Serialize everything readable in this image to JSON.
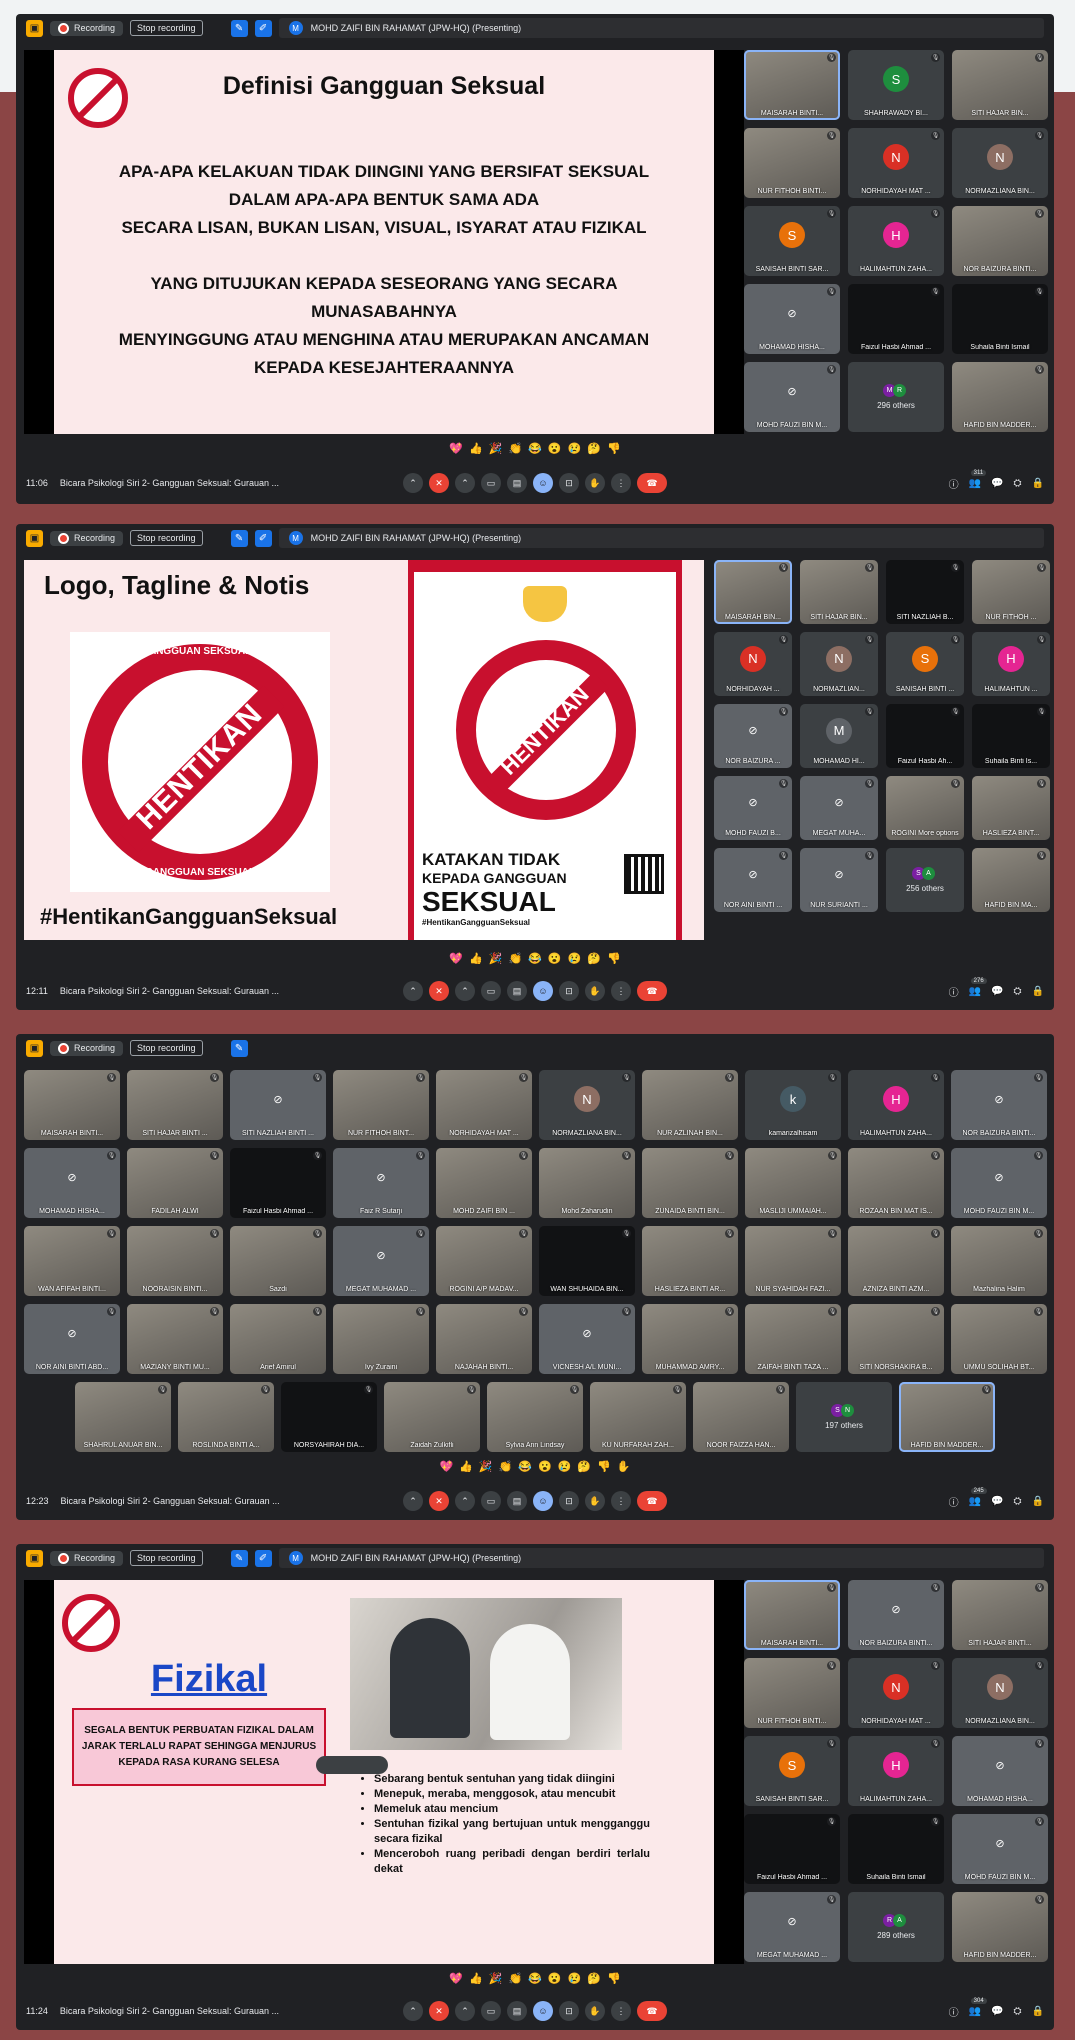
{
  "panels": [
    {
      "recording_label": "Recording",
      "stop_label": "Stop recording",
      "presenter_initial": "M",
      "presenter": "MOHD ZAIFI BIN RAHAMAT (JPW-HQ) (Presenting)",
      "slide": {
        "title": "Definisi Gangguan Seksual",
        "p1": [
          "APA-APA KELAKUAN TIDAK DIINGINI YANG BERSIFAT SEKSUAL",
          "DALAM APA-APA BENTUK SAMA ADA",
          "SECARA LISAN, BUKAN LISAN, VISUAL, ISYARAT ATAU FIZIKAL"
        ],
        "p2": [
          "YANG DITUJUKAN KEPADA SESEORANG YANG SECARA",
          "MUNASABAHNYA",
          "MENYINGGUNG ATAU MENGHINA ATAU MERUPAKAN ANCAMAN",
          "KEPADA KESEJAHTERAANNYA"
        ]
      },
      "tiles": [
        {
          "name": "MAISARAH BINTI...",
          "kind": "photo",
          "active": true
        },
        {
          "name": "SHAHRAWADY BI...",
          "initial": "S",
          "color": "#1e8e3e"
        },
        {
          "name": "SITI HAJAR BIN...",
          "kind": "photo"
        },
        {
          "name": "NUR FITHOH BINTI...",
          "kind": "photo"
        },
        {
          "name": "NORHIDAYAH MAT ...",
          "initial": "N",
          "color": "#d93025"
        },
        {
          "name": "NORMAZLIANA BIN...",
          "initial": "N",
          "color": "#8d6e63"
        },
        {
          "name": "SANISAH BINTI SAR...",
          "initial": "S",
          "color": "#e8710a"
        },
        {
          "name": "HALIMAHTUN ZAHA...",
          "initial": "H",
          "color": "#e52592"
        },
        {
          "name": "NOR BAIZURA BINTI...",
          "kind": "photo"
        },
        {
          "name": "MOHAMAD HISHA...",
          "kind": "grey"
        },
        {
          "name": "Faizul Hasbi Ahmad ...",
          "kind": "dark"
        },
        {
          "name": "Suhaila Binti Ismail",
          "kind": "dark"
        },
        {
          "name": "MOHD FAUZI BIN M...",
          "kind": "grey"
        },
        {
          "name": "296 others",
          "kind": "others",
          "a": "M",
          "b": "R"
        },
        {
          "name": "HAFID BIN MADDER...",
          "kind": "photo"
        }
      ],
      "reactions": [
        "💖",
        "👍",
        "🎉",
        "👏",
        "😂",
        "😮",
        "😢",
        "🤔",
        "👎"
      ],
      "time": "11:06",
      "meeting_title": "Bicara Psikologi Siri 2- Gangguan Seksual: Gurauan ...",
      "participants_count": "311"
    },
    {
      "recording_label": "Recording",
      "stop_label": "Stop recording",
      "presenter_initial": "M",
      "presenter": "MOHD ZAIFI BIN RAHAMAT (JPW-HQ) (Presenting)",
      "slide": {
        "title": "Logo, Tagline & Notis",
        "ring_top": "ANTIGANGGUAN SEKSUAL (AGS)",
        "ring_mid": "HENTIKAN",
        "ring_bottom": "GANGGUAN SEKSUAL",
        "hashtag": "#HentikanGangguanSeksual",
        "poster_line1": "KATAKAN TIDAK",
        "poster_line2": "KEPADA GANGGUAN",
        "poster_line3": "SEKSUAL",
        "poster_hashtag": "#HentikanGangguanSeksual"
      },
      "tiles": [
        {
          "name": "MAISARAH BIN...",
          "kind": "photo",
          "active": true
        },
        {
          "name": "SITI HAJAR BIN...",
          "kind": "photo"
        },
        {
          "name": "SITI NAZLIAH B...",
          "kind": "dark"
        },
        {
          "name": "NUR FITHOH ...",
          "kind": "photo"
        },
        {
          "name": "NORHIDAYAH ...",
          "initial": "N",
          "color": "#d93025"
        },
        {
          "name": "NORMAZLIAN...",
          "initial": "N",
          "color": "#8d6e63"
        },
        {
          "name": "SANISAH BINTI ...",
          "initial": "S",
          "color": "#e8710a"
        },
        {
          "name": "HALIMAHTUN ...",
          "initial": "H",
          "color": "#e52592"
        },
        {
          "name": "NOR BAIZURA ...",
          "kind": "grey"
        },
        {
          "name": "MOHAMAD HI...",
          "initial": "M",
          "color": "#5f6368"
        },
        {
          "name": "Faizul Hasbi Ah...",
          "kind": "dark"
        },
        {
          "name": "Suhaila Binti Is...",
          "kind": "dark"
        },
        {
          "name": "MOHD FAUZI B...",
          "kind": "grey"
        },
        {
          "name": "MEGAT MUHA...",
          "kind": "grey"
        },
        {
          "name": "ROGINI  More options",
          "kind": "photo"
        },
        {
          "name": "HASLIEZA BINT...",
          "kind": "photo"
        },
        {
          "name": "NOR AINI BINTI ...",
          "kind": "grey"
        },
        {
          "name": "NUR SURIANTI ...",
          "kind": "grey"
        },
        {
          "name": "256 others",
          "kind": "others",
          "a": "S",
          "b": "A"
        },
        {
          "name": "HAFID BIN MA...",
          "kind": "photo"
        }
      ],
      "reactions": [
        "💖",
        "👍",
        "🎉",
        "👏",
        "😂",
        "😮",
        "😢",
        "🤔",
        "👎"
      ],
      "time": "12:11",
      "meeting_title": "Bicara Psikologi Siri 2- Gangguan Seksual: Gurauan ...",
      "participants_count": "276"
    },
    {
      "recording_label": "Recording",
      "stop_label": "Stop recording",
      "tiles": [
        {
          "name": "MAISARAH BINTI...",
          "kind": "photo"
        },
        {
          "name": "SITI HAJAR BINTI ...",
          "kind": "photo"
        },
        {
          "name": "SITI NAZLIAH BINTI ...",
          "kind": "grey"
        },
        {
          "name": "NUR FITHOH BINT...",
          "kind": "photo"
        },
        {
          "name": "NORHIDAYAH MAT ...",
          "kind": "photo"
        },
        {
          "name": "NORMAZLIANA BIN...",
          "initial": "N",
          "color": "#8d6e63"
        },
        {
          "name": "NUR AZLINAH BIN...",
          "kind": "photo"
        },
        {
          "name": "kamarizalhisam",
          "initial": "k",
          "color": "#455a64"
        },
        {
          "name": "HALIMAHTUN ZAHA...",
          "initial": "H",
          "color": "#e52592"
        },
        {
          "name": "NOR BAIZURA BINTI...",
          "kind": "grey"
        },
        {
          "name": "MOHAMAD HISHA...",
          "kind": "grey"
        },
        {
          "name": "FADILAH ALWI",
          "kind": "photo"
        },
        {
          "name": "Faizul Hasbi Ahmad ...",
          "kind": "dark"
        },
        {
          "name": "Faiz R Sutarji",
          "kind": "grey"
        },
        {
          "name": "MOHD ZAIFI BIN ...",
          "kind": "photo"
        },
        {
          "name": "Mohd Zaharudin",
          "kind": "photo"
        },
        {
          "name": "ZUNAIDA BINTI BIN...",
          "kind": "photo"
        },
        {
          "name": "MASLIJI UMMAIAH...",
          "kind": "photo"
        },
        {
          "name": "ROZAAN BIN MAT IS...",
          "kind": "photo"
        },
        {
          "name": "MOHD FAUZI BIN M...",
          "kind": "grey"
        },
        {
          "name": "WAN AFIFAH BINTI...",
          "kind": "photo"
        },
        {
          "name": "NOORAISIN BINTI...",
          "kind": "photo"
        },
        {
          "name": "Sazdi",
          "kind": "photo"
        },
        {
          "name": "MEGAT MUHAMAD ...",
          "kind": "grey"
        },
        {
          "name": "ROGINI A/P MADAV...",
          "kind": "photo"
        },
        {
          "name": "WAN SHUHAIDA BIN...",
          "kind": "dark"
        },
        {
          "name": "HASLIEZA BINTI AR...",
          "kind": "photo"
        },
        {
          "name": "NUR SYAHIDAH FAZI...",
          "kind": "photo"
        },
        {
          "name": "AZNIZA BINTI AZM...",
          "kind": "photo"
        },
        {
          "name": "Mazhalina Halim",
          "kind": "photo"
        },
        {
          "name": "NOR AINI BINTI ABD...",
          "kind": "grey"
        },
        {
          "name": "MAZIANY BINTI MU...",
          "kind": "photo"
        },
        {
          "name": "Arief Amirul",
          "kind": "photo"
        },
        {
          "name": "Ivy Zuraini",
          "kind": "photo"
        },
        {
          "name": "NAJAHAH BINTI...",
          "kind": "photo"
        },
        {
          "name": "VICNESH A/L MUNI...",
          "kind": "grey"
        },
        {
          "name": "MUHAMMAD AMRY...",
          "kind": "photo"
        },
        {
          "name": "ZAIFAH BINTI TAZA ...",
          "kind": "photo"
        },
        {
          "name": "SITI NORSHAKIRA B...",
          "kind": "photo"
        },
        {
          "name": "UMMU SOLIHAH BT...",
          "kind": "photo"
        },
        {
          "name": "SHAHRUL ANUAR BIN...",
          "kind": "photo"
        },
        {
          "name": "ROSLINDA BINTI A...",
          "kind": "photo"
        },
        {
          "name": "NORSYAHIRAH DIA...",
          "kind": "dark"
        },
        {
          "name": "Zaidah Zulkifli",
          "kind": "photo"
        },
        {
          "name": "Sylvia Ann Lindsay",
          "kind": "photo"
        },
        {
          "name": "KU NURFARAH ZAH...",
          "kind": "photo"
        },
        {
          "name": "NOOR FAIZZA HAN...",
          "kind": "photo"
        },
        {
          "name": "197 others",
          "kind": "others",
          "a": "S",
          "b": "N"
        },
        {
          "name": "HAFID BIN MADDER...",
          "kind": "photo",
          "active": true
        }
      ],
      "reactions": [
        "💖",
        "👍",
        "🎉",
        "👏",
        "😂",
        "😮",
        "😢",
        "🤔",
        "👎",
        "✋"
      ],
      "time": "12:23",
      "meeting_title": "Bicara Psikologi Siri 2- Gangguan Seksual: Gurauan ...",
      "participants_count": "245"
    },
    {
      "recording_label": "Recording",
      "stop_label": "Stop recording",
      "presenter_initial": "M",
      "presenter": "MOHD ZAIFI BIN RAHAMAT (JPW-HQ) (Presenting)",
      "slide": {
        "title": "Fizikal",
        "box": [
          "SEGALA BENTUK PERBUATAN FIZIKAL DALAM",
          "JARAK TERLALU RAPAT SEHINGGA MENJURUS",
          "KEPADA RASA KURANG SELESA"
        ],
        "bullets": [
          "Sebarang bentuk sentuhan yang tidak diingini",
          "Menepuk, meraba, menggosok, atau mencubit",
          "Memeluk atau mencium",
          "Sentuhan fizikal yang bertujuan untuk mengganggu secara fizikal",
          "Menceroboh ruang peribadi dengan berdiri terlalu dekat"
        ]
      },
      "tiles": [
        {
          "name": "MAISARAH BINTI...",
          "kind": "photo",
          "active": true
        },
        {
          "name": "NOR BAIZURA BINTI...",
          "kind": "grey"
        },
        {
          "name": "SITI HAJAR BINTI...",
          "kind": "photo"
        },
        {
          "name": "NUR FITHOH BINTI...",
          "kind": "photo"
        },
        {
          "name": "NORHIDAYAH MAT ...",
          "initial": "N",
          "color": "#d93025"
        },
        {
          "name": "NORMAZLIANA BIN...",
          "initial": "N",
          "color": "#8d6e63"
        },
        {
          "name": "SANISAH BINTI SAR...",
          "initial": "S",
          "color": "#e8710a"
        },
        {
          "name": "HALIMAHTUN ZAHA...",
          "initial": "H",
          "color": "#e52592"
        },
        {
          "name": "MOHAMAD HISHA...",
          "kind": "grey"
        },
        {
          "name": "Faizul Hasbi Ahmad ...",
          "kind": "dark"
        },
        {
          "name": "Suhaila Binti Ismail",
          "kind": "dark"
        },
        {
          "name": "MOHD FAUZI BIN M...",
          "kind": "grey"
        },
        {
          "name": "MEGAT MUHAMAD ...",
          "kind": "grey"
        },
        {
          "name": "289 others",
          "kind": "others",
          "a": "R",
          "b": "A"
        },
        {
          "name": "HAFID BIN MADDER...",
          "kind": "photo"
        }
      ],
      "reactions": [
        "💖",
        "👍",
        "🎉",
        "👏",
        "😂",
        "😮",
        "😢",
        "🤔",
        "👎"
      ],
      "time": "11:24",
      "meeting_title": "Bicara Psikologi Siri 2- Gangguan Seksual: Gurauan ...",
      "participants_count": "304"
    }
  ]
}
